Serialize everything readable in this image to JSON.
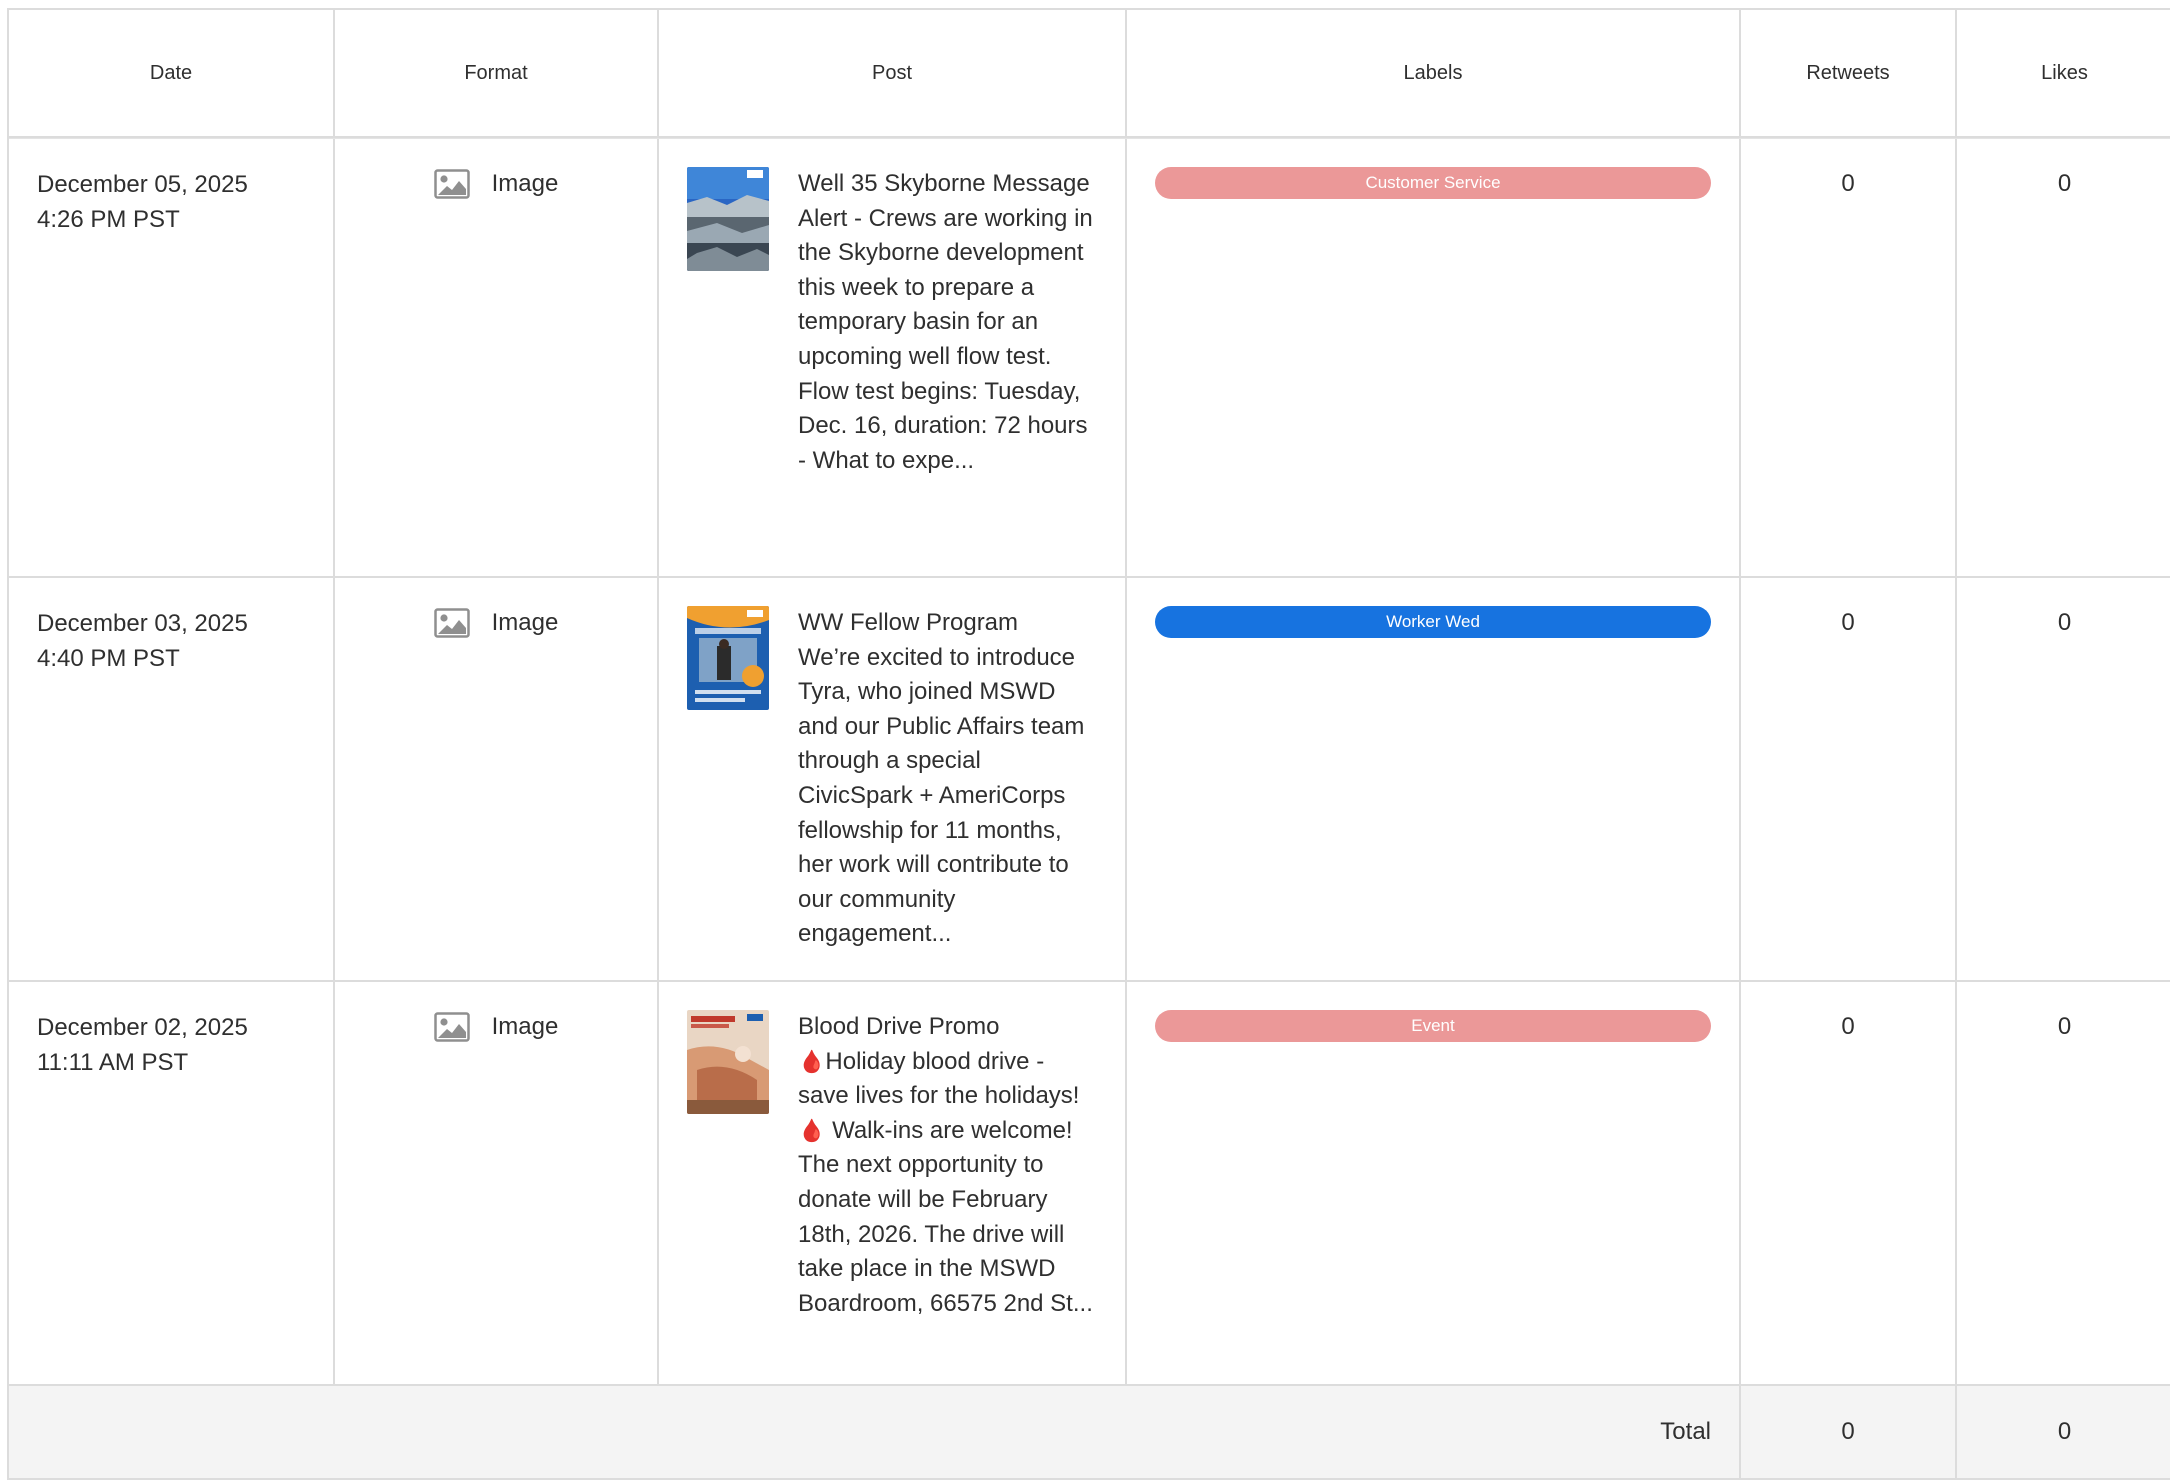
{
  "table": {
    "columns": {
      "date": "Date",
      "format": "Format",
      "post": "Post",
      "labels": "Labels",
      "retweets": "Retweets",
      "likes": "Likes"
    },
    "rows": [
      {
        "date": "December 05, 2025",
        "time": "4:26 PM PST",
        "format": "Image",
        "post_title": "Well 35 Skyborne Message",
        "post_body": "Alert - Crews are working in the Skyborne development this week to prepare a temporary basin for an upcoming well flow test. Flow test begins: Tuesday, Dec. 16, duration: 72 hours - What to expe...",
        "label": "Customer Service",
        "label_color": "#eb9898",
        "retweets": "0",
        "likes": "0"
      },
      {
        "date": "December 03, 2025",
        "time": "4:40 PM PST",
        "format": "Image",
        "post_title": "WW Fellow Program",
        "post_body": "We’re excited to introduce Tyra, who joined MSWD and our Public Affairs team through a special CivicSpark + AmeriCorps fellowship for 11 months, her work will contribute to our community engagement...",
        "label": "Worker Wed",
        "label_color": "#1773e0",
        "retweets": "0",
        "likes": "0"
      },
      {
        "date": "December 02, 2025",
        "time": "11:11 AM PST",
        "format": "Image",
        "post_title": "Blood Drive Promo",
        "post_body_line1": "Holiday blood drive - save lives for the holidays!",
        "post_body_line2": " Walk-ins are welcome! The next opportunity to donate will be February 18th, 2026. The drive will take place in the MSWD Boardroom, 66575 2nd St...",
        "emoji": "🩸",
        "label": "Event",
        "label_color": "#eb9898",
        "retweets": "0",
        "likes": "0"
      }
    ],
    "total": {
      "label": "Total",
      "retweets": "0",
      "likes": "0"
    }
  },
  "icons": {
    "format_icon": "image-icon"
  }
}
